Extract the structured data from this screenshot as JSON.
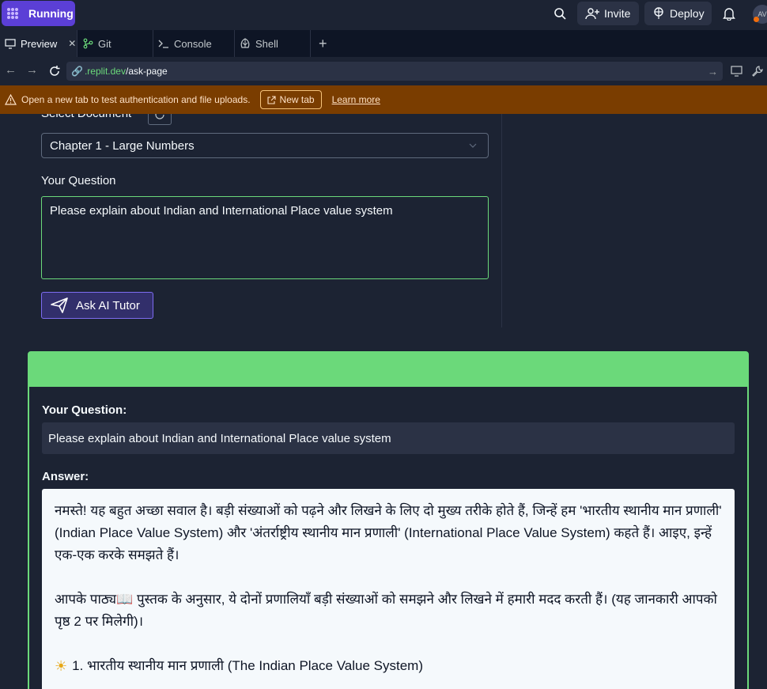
{
  "topbar": {
    "run_label": "Running",
    "invite_label": "Invite",
    "deploy_label": "Deploy",
    "avatar_initials": "AV"
  },
  "tabs": [
    {
      "label": "Preview",
      "icon": "monitor-icon"
    },
    {
      "label": "Git",
      "icon": "git-icon"
    },
    {
      "label": "Console",
      "icon": "terminal-icon"
    },
    {
      "label": "Shell",
      "icon": "shell-icon"
    }
  ],
  "url": {
    "domain": ".replit.dev",
    "path": "/ask-page"
  },
  "warning": {
    "text": "Open a new tab to test authentication and file uploads.",
    "newtab_label": "New tab",
    "learn_more": "Learn more"
  },
  "form": {
    "select_doc_label": "Select Document",
    "selected_document": "Chapter 1 - Large Numbers",
    "question_label": "Your Question",
    "question_value": "Please explain about Indian and International Place value system",
    "ask_button": "Ask AI Tutor"
  },
  "result": {
    "question_heading": "Your Question:",
    "question_text": "Please explain about Indian and International Place value system",
    "answer_heading": "Answer:",
    "answer_p1": "नमस्ते! यह बहुत अच्छा सवाल है। बड़ी संख्याओं को पढ़ने और लिखने के लिए दो मुख्य तरीके होते हैं, जिन्हें हम 'भारतीय स्थानीय मान प्रणाली' (Indian Place Value System) और 'अंतर्राष्ट्रीय स्थानीय मान प्रणाली' (International Place Value System) कहते हैं। आइए, इन्हें एक-एक करके समझते हैं।",
    "answer_p2": "आपके पाठ्य📖 पुस्तक के अनुसार, ये दोनों प्रणालियाँ बड़ी संख्याओं को समझने और लिखने में हमारी मदद करती हैं। (यह जानकारी आपको पृष्ठ 2 पर मिलेगी)।",
    "answer_p3": "1. भारतीय स्थानीय मान प्रणाली (The Indian Place Value System)"
  },
  "colors": {
    "accent_green": "#6bd97a",
    "run_purple": "#5b3fd6",
    "warning_bg": "#7a3d00"
  }
}
